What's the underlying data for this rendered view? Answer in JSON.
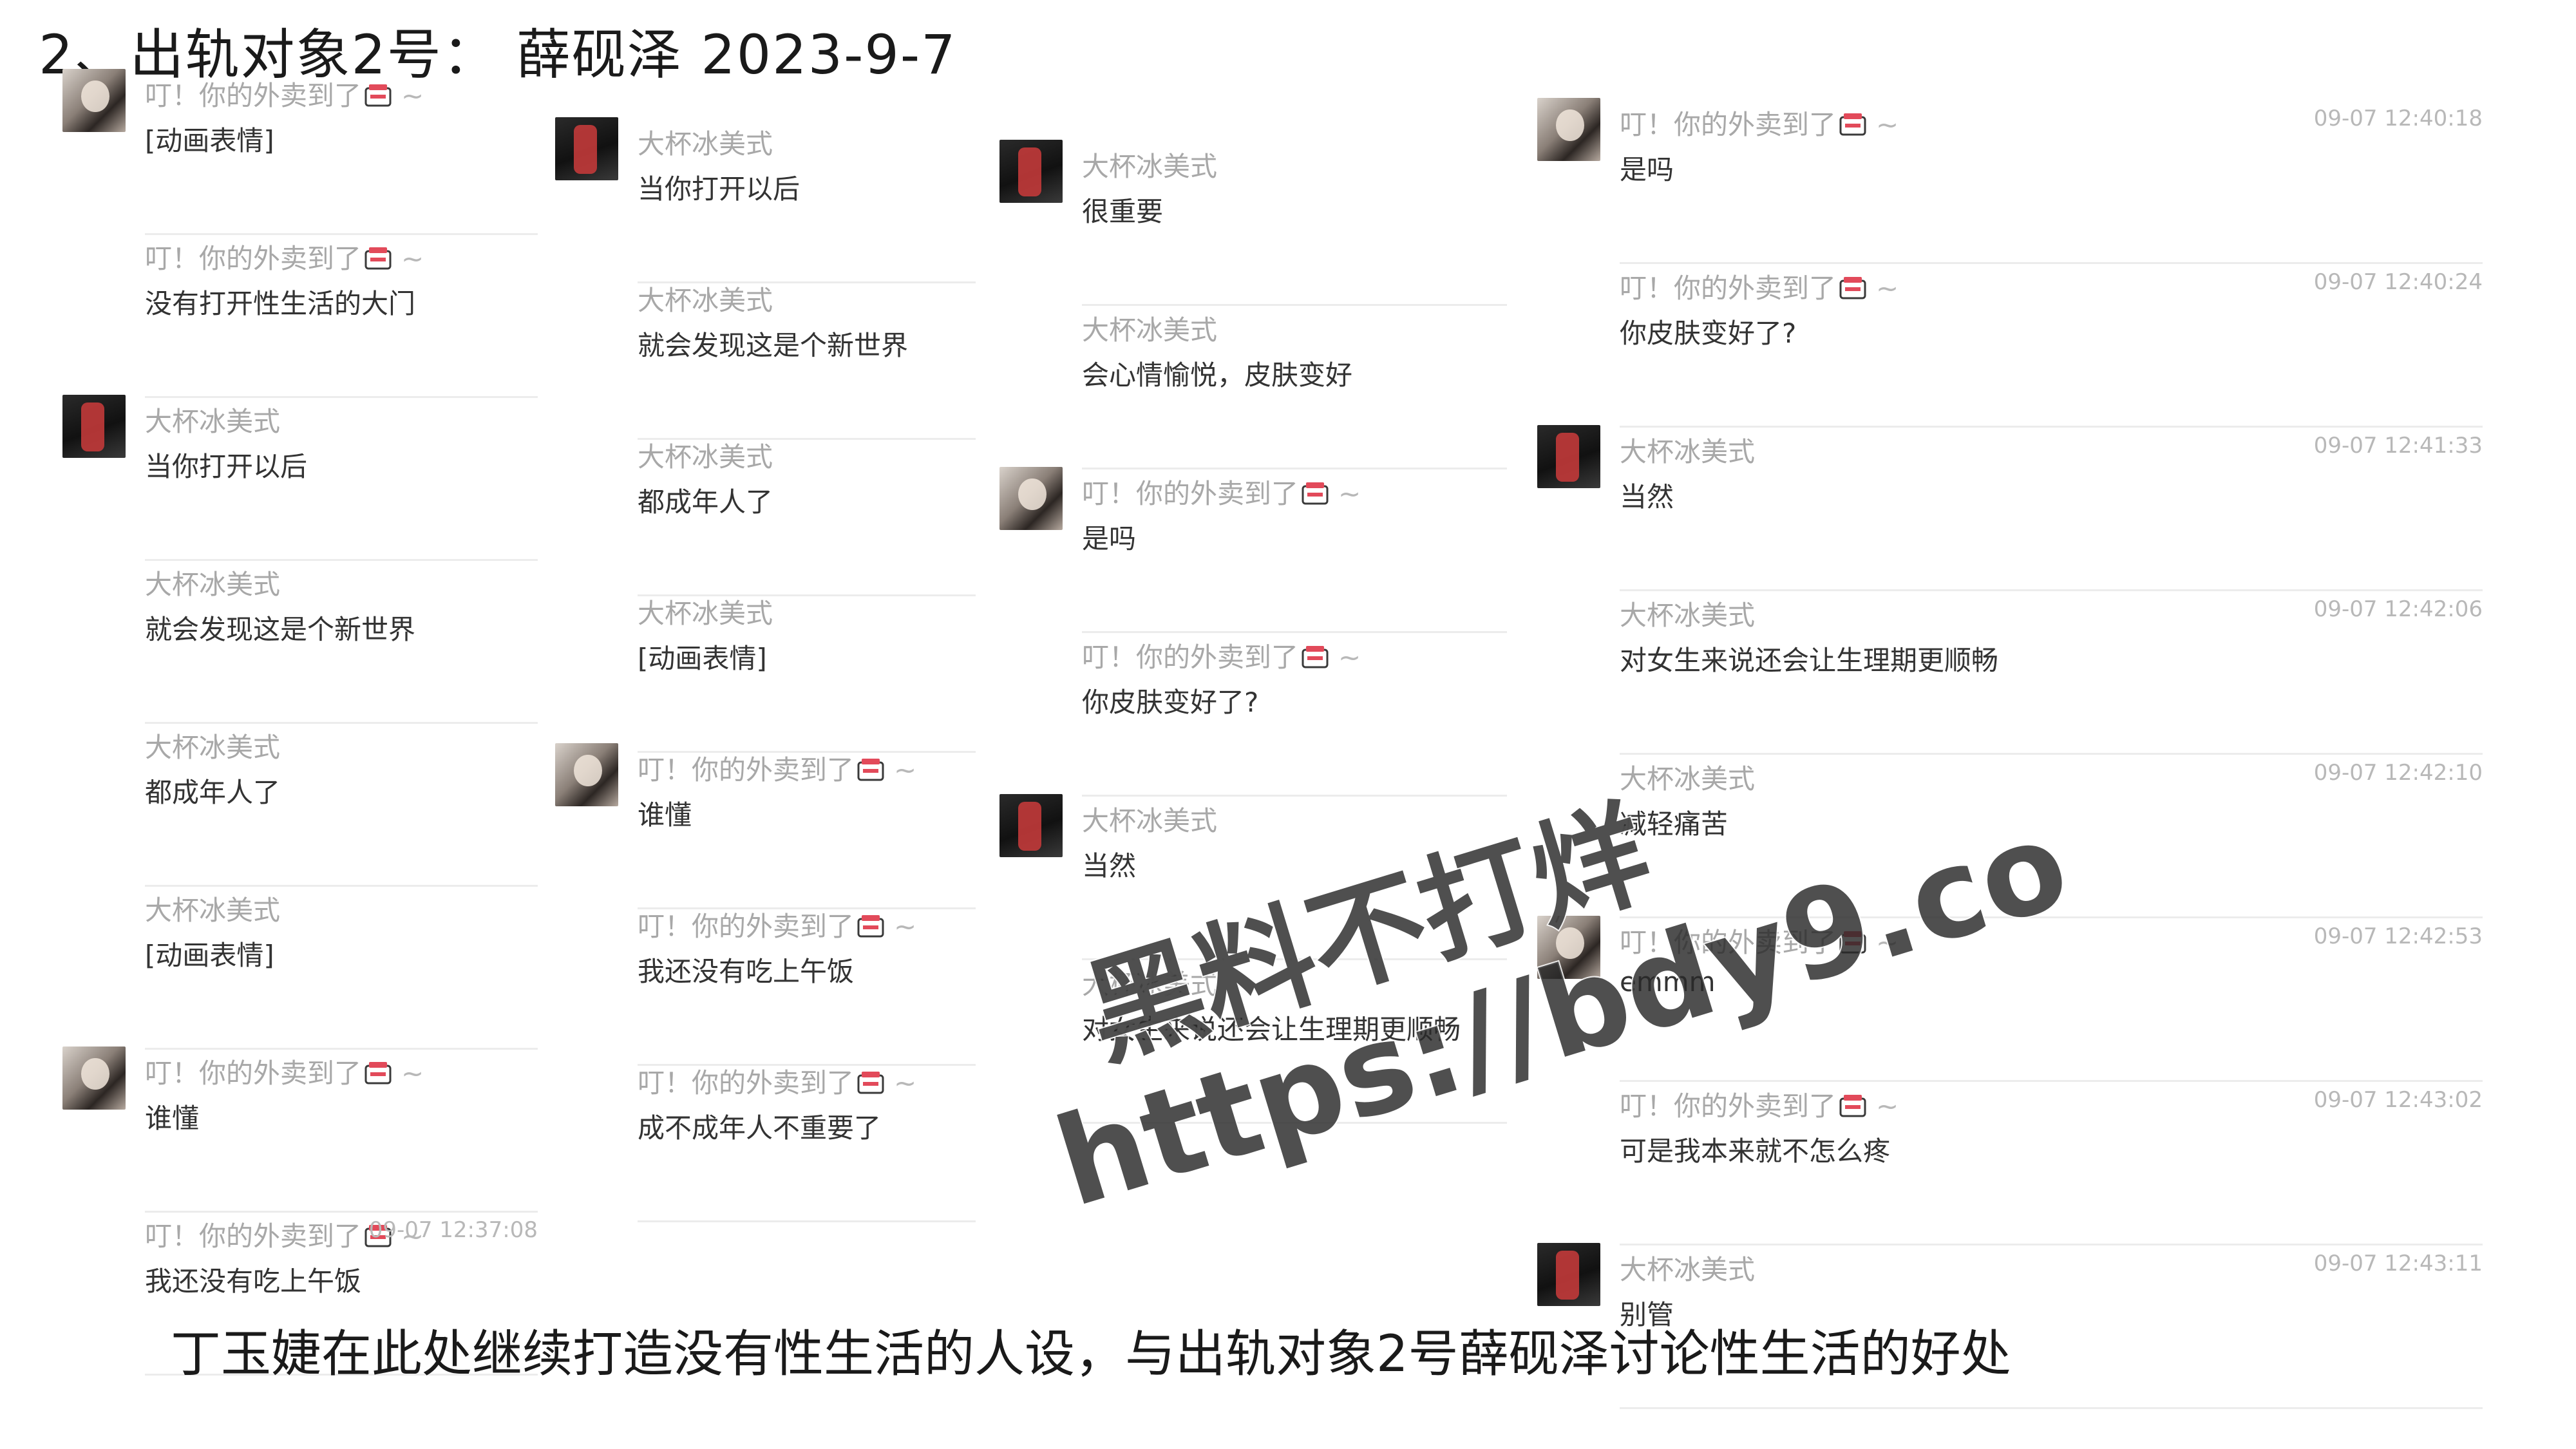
{
  "title": "2、出轨对象2号： 薛砚泽 2023-9-7",
  "caption": "丁玉婕在此处继续打造没有性生活的人设，与出轨对象2号薛砚泽讨论性生活的好处",
  "watermark": {
    "line1": "黑料不打烊",
    "line2": "https://bdy9.co"
  },
  "names": {
    "her": "叮！你的外卖到了",
    "him": "大杯冰美式"
  },
  "columns": [
    {
      "messages": [
        {
          "sender": "her",
          "avatar": "girl",
          "text": "[动画表情]",
          "time": ""
        },
        {
          "sender": "her",
          "avatar": "",
          "text": "没有打开性生活的大门",
          "time": ""
        },
        {
          "sender": "him",
          "avatar": "dark",
          "text": "当你打开以后",
          "time": ""
        },
        {
          "sender": "him",
          "avatar": "",
          "text": "就会发现这是个新世界",
          "time": ""
        },
        {
          "sender": "him",
          "avatar": "",
          "text": "都成年人了",
          "time": ""
        },
        {
          "sender": "him",
          "avatar": "",
          "text": "[动画表情]",
          "time": ""
        },
        {
          "sender": "her",
          "avatar": "girl",
          "text": "谁懂",
          "time": ""
        },
        {
          "sender": "her",
          "avatar": "",
          "text": "我还没有吃上午饭",
          "time": "09-07 12:37:08"
        }
      ]
    },
    {
      "messages": [
        {
          "sender": "him",
          "avatar": "dark",
          "text": "当你打开以后",
          "time": ""
        },
        {
          "sender": "him",
          "avatar": "",
          "text": "就会发现这是个新世界",
          "time": ""
        },
        {
          "sender": "him",
          "avatar": "",
          "text": "都成年人了",
          "time": ""
        },
        {
          "sender": "him",
          "avatar": "",
          "text": "[动画表情]",
          "time": ""
        },
        {
          "sender": "her",
          "avatar": "girl",
          "text": "谁懂",
          "time": ""
        },
        {
          "sender": "her",
          "avatar": "",
          "text": "我还没有吃上午饭",
          "time": ""
        },
        {
          "sender": "her",
          "avatar": "",
          "text": "成不成年人不重要了",
          "time": ""
        }
      ]
    },
    {
      "messages": [
        {
          "sender": "him",
          "avatar": "dark",
          "text": "很重要",
          "time": ""
        },
        {
          "sender": "him",
          "avatar": "",
          "text": "会心情愉悦，皮肤变好",
          "time": ""
        },
        {
          "sender": "her",
          "avatar": "girl",
          "text": "是吗",
          "time": ""
        },
        {
          "sender": "her",
          "avatar": "",
          "text": "你皮肤变好了?",
          "time": ""
        },
        {
          "sender": "him",
          "avatar": "dark",
          "text": "当然",
          "time": ""
        },
        {
          "sender": "him",
          "avatar": "",
          "text": "对女生来说还会让生理期更顺畅",
          "time": ""
        }
      ]
    },
    {
      "messages": [
        {
          "sender": "her",
          "avatar": "girl",
          "text": "是吗",
          "time": "09-07 12:40:18"
        },
        {
          "sender": "her",
          "avatar": "",
          "text": "你皮肤变好了?",
          "time": "09-07 12:40:24"
        },
        {
          "sender": "him",
          "avatar": "dark",
          "text": "当然",
          "time": "09-07 12:41:33"
        },
        {
          "sender": "him",
          "avatar": "",
          "text": "对女生来说还会让生理期更顺畅",
          "time": "09-07 12:42:06"
        },
        {
          "sender": "him",
          "avatar": "",
          "text": "减轻痛苦",
          "time": "09-07 12:42:10"
        },
        {
          "sender": "her",
          "avatar": "girl",
          "text": "emmm",
          "time": "09-07 12:42:53"
        },
        {
          "sender": "her",
          "avatar": "",
          "text": "可是我本来就不怎么疼",
          "time": "09-07 12:43:02"
        },
        {
          "sender": "him",
          "avatar": "dark",
          "text": "别管",
          "time": "09-07 12:43:11"
        }
      ]
    }
  ]
}
